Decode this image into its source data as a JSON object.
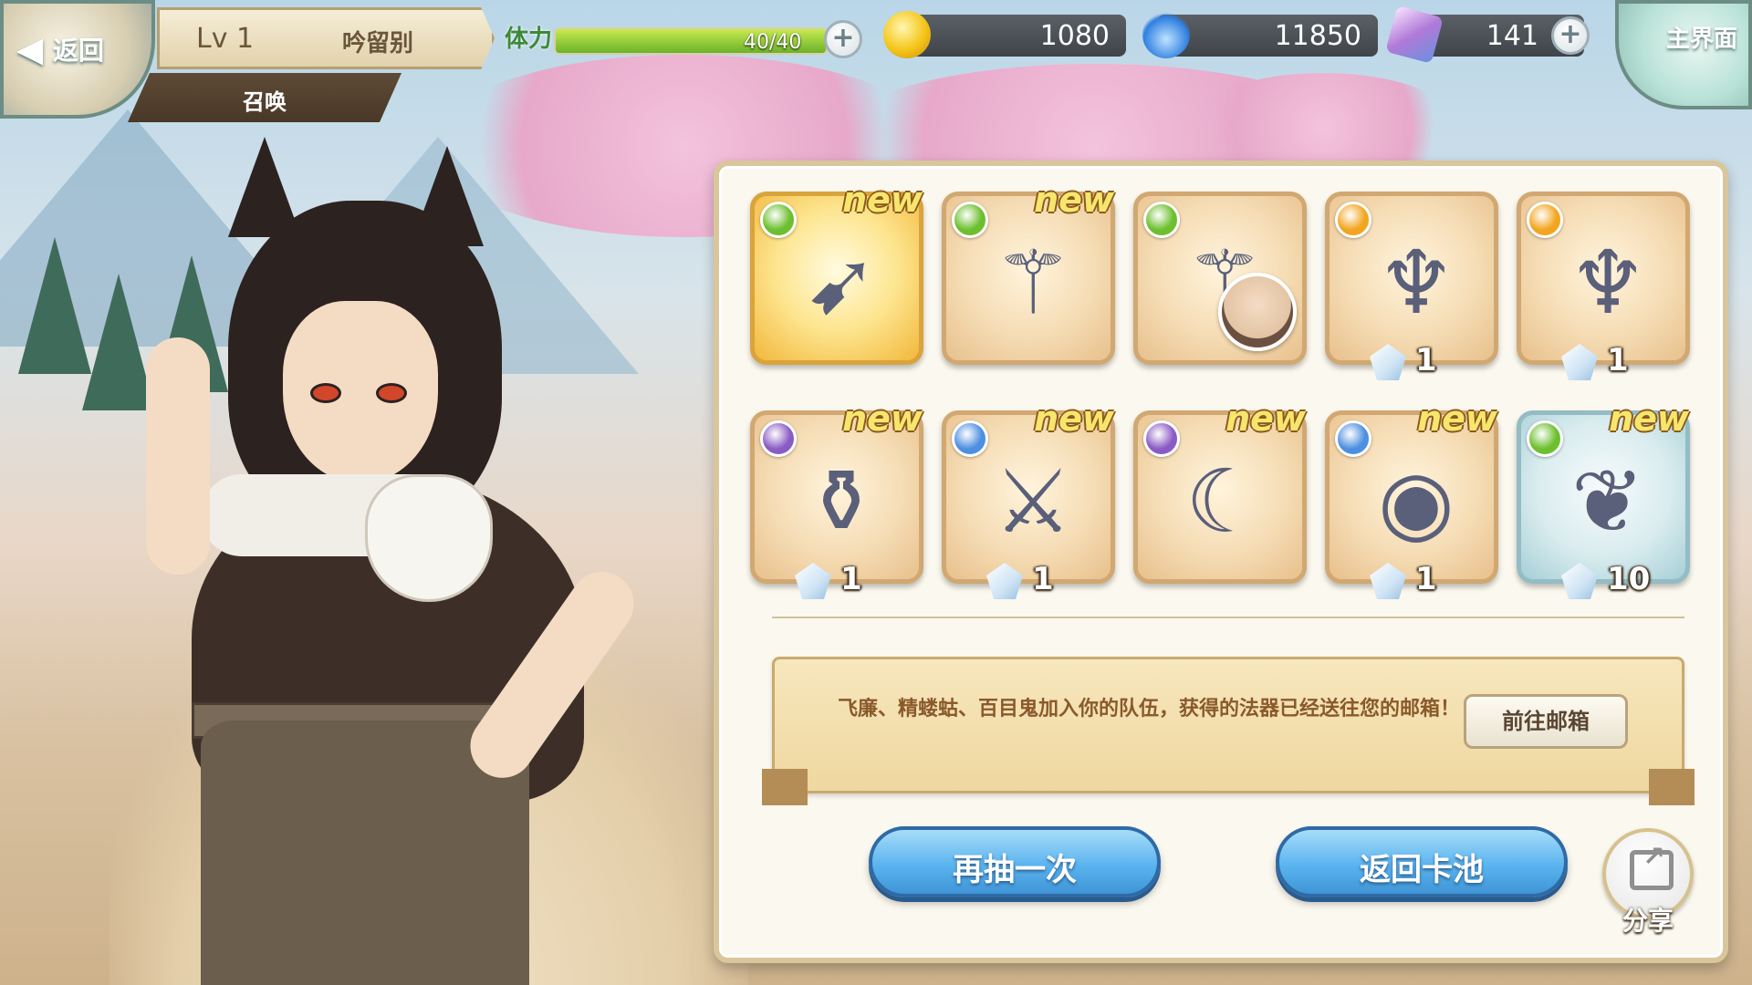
{
  "top_bar": {
    "back_label": "返回",
    "level_label": "Lv 1",
    "player_name": "吟留别",
    "section_label": "召唤",
    "stamina": {
      "label": "体力",
      "value": "40/40",
      "fraction": 1.0
    },
    "gold": {
      "value": "1080",
      "icon": "gold-coin-icon",
      "color": "#f5c518"
    },
    "spirit": {
      "value": "11850",
      "icon": "blue-flame-icon",
      "color": "#2f7fe0"
    },
    "gems": {
      "value": "141",
      "icon": "crystal-gem-icon",
      "color": "#b07ad8"
    },
    "plus_symbol": "+",
    "home_label": "主界面"
  },
  "results": {
    "items": [
      {
        "name": "bow-weapon",
        "element": "wind",
        "element_color": "#6cbf2e",
        "new_tag": "new",
        "count": "",
        "rarity": "gold",
        "icon": "bow-icon",
        "avatar": false
      },
      {
        "name": "staff-weapon",
        "element": "wind",
        "element_color": "#6cbf2e",
        "new_tag": "new",
        "count": "",
        "rarity": "normal",
        "icon": "staff-icon",
        "avatar": false
      },
      {
        "name": "staff-weapon-character",
        "element": "wind",
        "element_color": "#6cbf2e",
        "new_tag": "",
        "count": "",
        "rarity": "normal",
        "icon": "staff-icon",
        "avatar": true
      },
      {
        "name": "claw-weapon",
        "element": "fire",
        "element_color": "#f2a51e",
        "new_tag": "",
        "count": "1",
        "rarity": "normal",
        "icon": "claw-icon",
        "avatar": false
      },
      {
        "name": "claw-weapon",
        "element": "fire",
        "element_color": "#f2a51e",
        "new_tag": "",
        "count": "1",
        "rarity": "normal",
        "icon": "claw-icon",
        "avatar": false
      },
      {
        "name": "lantern-weapon",
        "element": "dark",
        "element_color": "#8a5bc4",
        "new_tag": "new",
        "count": "1",
        "rarity": "normal",
        "icon": "lantern-icon",
        "avatar": false
      },
      {
        "name": "blade-glove-weapon",
        "element": "water",
        "element_color": "#4d8fe0",
        "new_tag": "new",
        "count": "1",
        "rarity": "normal",
        "icon": "blade-icon",
        "avatar": false
      },
      {
        "name": "beast-summon",
        "element": "dark",
        "element_color": "#8a5bc4",
        "new_tag": "new",
        "count": "",
        "rarity": "normal",
        "icon": "beast-icon",
        "avatar": false
      },
      {
        "name": "orb-weapon",
        "element": "water",
        "element_color": "#4d8fe0",
        "new_tag": "new",
        "count": "1",
        "rarity": "normal",
        "icon": "orb-icon",
        "avatar": false
      },
      {
        "name": "leaf-orb-weapon",
        "element": "wind",
        "element_color": "#6cbf2e",
        "new_tag": "new",
        "count": "10",
        "rarity": "teal",
        "icon": "leaf-orb-icon",
        "avatar": false
      }
    ],
    "message": "飞廉、精蝼蛄、百目鬼加入你的队伍，获得的法器已经送往您的邮箱！",
    "mailbox_button": "前往邮箱",
    "draw_again_button": "再抽一次",
    "return_pool_button": "返回卡池",
    "share_label": "分享"
  }
}
